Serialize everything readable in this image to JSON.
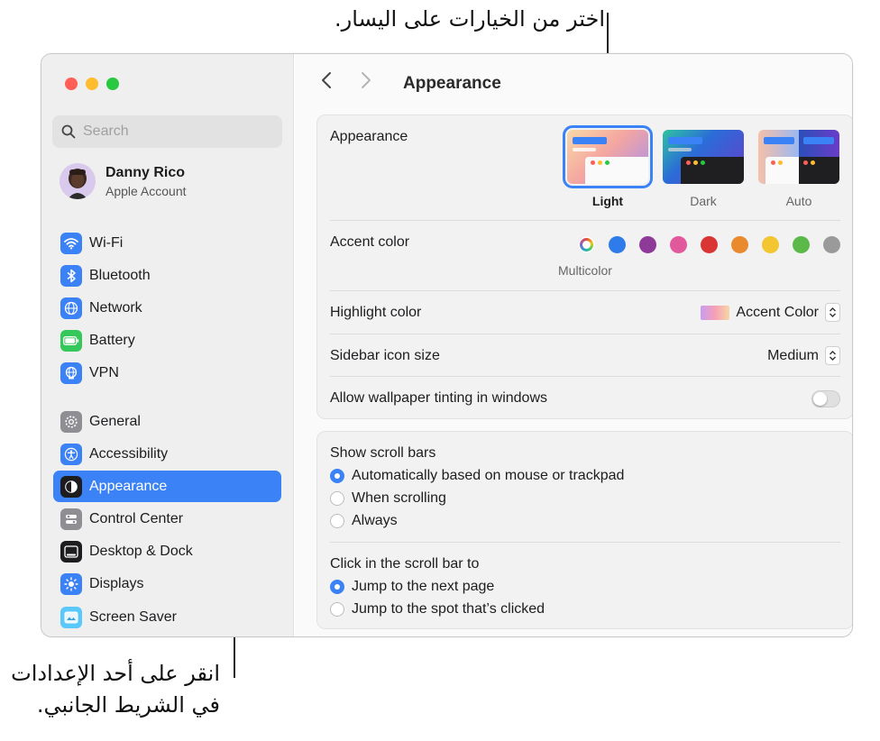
{
  "callouts": {
    "top": "اختر من الخيارات على اليسار.",
    "bottom_line1": "انقر على أحد الإعدادات",
    "bottom_line2": "في الشريط الجانبي."
  },
  "sidebar": {
    "search_placeholder": "Search",
    "account": {
      "name": "Danny Rico",
      "subtitle": "Apple Account"
    },
    "items": [
      {
        "label": "Wi-Fi",
        "icon": "wifi-icon",
        "color": "#3b82f6"
      },
      {
        "label": "Bluetooth",
        "icon": "bluetooth-icon",
        "color": "#3b82f6"
      },
      {
        "label": "Network",
        "icon": "globe-icon",
        "color": "#3b82f6"
      },
      {
        "label": "Battery",
        "icon": "battery-icon",
        "color": "#34c759"
      },
      {
        "label": "VPN",
        "icon": "vpn-globe-icon",
        "color": "#3b82f6"
      },
      {
        "label": "General",
        "icon": "gear-icon",
        "color": "#8e8e93"
      },
      {
        "label": "Accessibility",
        "icon": "accessibility-icon",
        "color": "#3b82f6"
      },
      {
        "label": "Appearance",
        "icon": "appearance-icon",
        "color": "#1d1d1f",
        "selected": true
      },
      {
        "label": "Control Center",
        "icon": "control-center-icon",
        "color": "#8e8e93"
      },
      {
        "label": "Desktop & Dock",
        "icon": "dock-icon",
        "color": "#1d1d1f"
      },
      {
        "label": "Displays",
        "icon": "sun-icon",
        "color": "#3b82f6"
      },
      {
        "label": "Screen Saver",
        "icon": "screen-saver-icon",
        "color": "#5ac8fa"
      }
    ]
  },
  "main": {
    "title": "Appearance",
    "appearance": {
      "label": "Appearance",
      "options": [
        {
          "label": "Light",
          "selected": true
        },
        {
          "label": "Dark",
          "selected": false
        },
        {
          "label": "Auto",
          "selected": false
        }
      ]
    },
    "accent": {
      "label": "Accent color",
      "selected_name": "Multicolor",
      "colors": [
        "#8e44ad",
        "#2f7bea",
        "#8e3a99",
        "#e2589c",
        "#d93535",
        "#ea8a2e",
        "#f2c531",
        "#5bb94a",
        "#9a9a9a"
      ]
    },
    "highlight": {
      "label": "Highlight color",
      "value": "Accent Color"
    },
    "sidebar_icon_size": {
      "label": "Sidebar icon size",
      "value": "Medium"
    },
    "wallpaper_tinting": {
      "label": "Allow wallpaper tinting in windows",
      "on": false
    },
    "scroll_bars": {
      "label": "Show scroll bars",
      "options": [
        {
          "label": "Automatically based on mouse or trackpad",
          "selected": true
        },
        {
          "label": "When scrolling",
          "selected": false
        },
        {
          "label": "Always",
          "selected": false
        }
      ]
    },
    "click_scroll": {
      "label": "Click in the scroll bar to",
      "options": [
        {
          "label": "Jump to the next page",
          "selected": true
        },
        {
          "label": "Jump to the spot that’s clicked",
          "selected": false
        }
      ]
    }
  }
}
